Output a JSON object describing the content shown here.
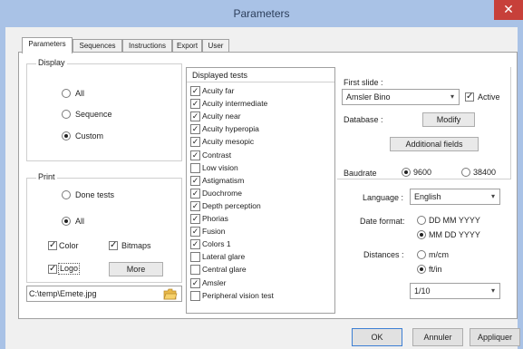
{
  "window": {
    "title": "Parameters",
    "close_glyph": "✕"
  },
  "tabs": [
    "Parameters",
    "Sequences",
    "Instructions",
    "Export",
    "User"
  ],
  "display": {
    "label": "Display",
    "options": [
      "All",
      "Sequence",
      "Custom"
    ],
    "selected": 2
  },
  "print": {
    "label": "Print",
    "options": [
      "Done tests",
      "All"
    ],
    "selected": 1,
    "color_label": "Color",
    "bitmaps_label": "Bitmaps",
    "logo_label": "Logo",
    "more_label": "More",
    "logo_path": "C:\\temp\\Emete.jpg"
  },
  "tests": {
    "header": "Displayed tests",
    "items": [
      {
        "label": "Acuity far",
        "checked": true
      },
      {
        "label": "Acuity intermediate",
        "checked": true
      },
      {
        "label": "Acuity near",
        "checked": true
      },
      {
        "label": "Acuity hyperopia",
        "checked": true
      },
      {
        "label": "Acuity mesopic",
        "checked": true
      },
      {
        "label": "Contrast",
        "checked": true
      },
      {
        "label": "Low vision",
        "checked": false
      },
      {
        "label": "Astigmatism",
        "checked": true
      },
      {
        "label": "Duochrome",
        "checked": true
      },
      {
        "label": "Depth perception",
        "checked": true
      },
      {
        "label": "Phorias",
        "checked": true
      },
      {
        "label": "Fusion",
        "checked": true
      },
      {
        "label": "Colors 1",
        "checked": true
      },
      {
        "label": "Lateral glare",
        "checked": false
      },
      {
        "label": "Central glare",
        "checked": false
      },
      {
        "label": "Amsler",
        "checked": true
      },
      {
        "label": "Peripheral vision test",
        "checked": false
      }
    ]
  },
  "first_slide": {
    "label": "First slide :",
    "value": "Amsler Bino",
    "active_label": "Active"
  },
  "database": {
    "label": "Database :",
    "modify_label": "Modify",
    "additional_label": "Additional fields"
  },
  "baudrate": {
    "label": "Baudrate",
    "options": [
      "9600",
      "38400"
    ],
    "selected": 0
  },
  "language": {
    "label": "Language :",
    "value": "English"
  },
  "date_format": {
    "label": "Date format:",
    "options": [
      "DD MM YYYY",
      "MM DD YYYY"
    ],
    "selected": 1
  },
  "distances": {
    "label": "Distances :",
    "options": [
      "m/cm",
      "ft/in"
    ],
    "selected": 1,
    "scale_value": "1/10"
  },
  "buttons": {
    "ok": "OK",
    "cancel": "Annuler",
    "apply": "Appliquer"
  },
  "icons": {
    "chevron": "chevron-down-icon",
    "check": "check-icon",
    "folder": "folder-icon"
  }
}
